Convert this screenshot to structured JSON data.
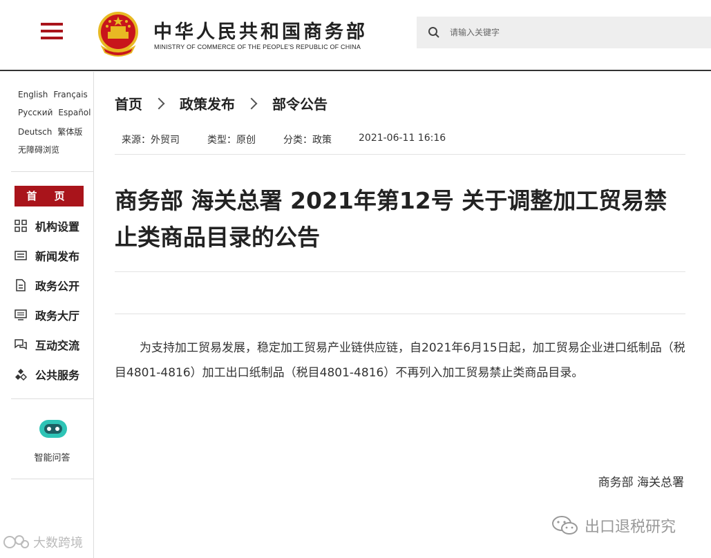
{
  "header": {
    "site_name_cn": "中华人民共和国商务部",
    "site_name_en": "MINISTRY OF COMMERCE OF THE PEOPLE'S REPUBLIC OF CHINA",
    "search_placeholder": "请输入关键字",
    "brand_color": "#a9141b"
  },
  "sidebar": {
    "languages": [
      [
        "English",
        "Français"
      ],
      [
        "Русский",
        "Español"
      ],
      [
        "Deutsch",
        "繁体版"
      ],
      [
        "无障碍浏览"
      ]
    ],
    "home_label": "首 页",
    "nav": [
      {
        "label": "机构设置",
        "icon": "grid-icon"
      },
      {
        "label": "新闻发布",
        "icon": "news-icon"
      },
      {
        "label": "政务公开",
        "icon": "document-icon"
      },
      {
        "label": "政务大厅",
        "icon": "monitor-icon"
      },
      {
        "label": "互动交流",
        "icon": "chat-icon"
      },
      {
        "label": "公共服务",
        "icon": "service-icon"
      }
    ],
    "ai_label": "智能问答"
  },
  "breadcrumb": [
    "首页",
    "政策发布",
    "部令公告"
  ],
  "meta": {
    "source": "来源：外贸司",
    "type": "类型：原创",
    "category": "分类：政策",
    "datetime": "2021-06-11 16:16"
  },
  "article": {
    "title": "商务部 海关总署 2021年第12号 关于调整加工贸易禁止类商品目录的公告",
    "body": "为支持加工贸易发展，稳定加工贸易产业链供应链，自2021年6月15日起，加工贸易企业进口纸制品（税目4801-4816）加工出口纸制品（税目4801-4816）不再列入加工贸易禁止类商品目录。",
    "signature": "商务部 海关总署"
  },
  "watermarks": {
    "left": "大数跨境",
    "right": "出口退税研究"
  }
}
